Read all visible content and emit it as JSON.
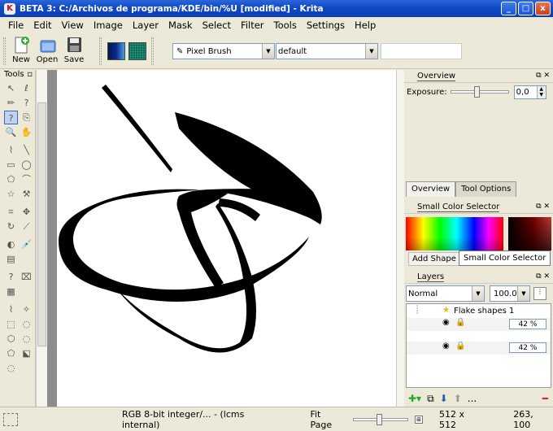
{
  "window": {
    "title": "BETA 3: C:/Archivos de programa/KDE/bin/%U [modified] - Krita",
    "min_label": "_",
    "max_label": "□",
    "close_label": "x"
  },
  "menu": [
    "File",
    "Edit",
    "View",
    "Image",
    "Layer",
    "Mask",
    "Select",
    "Filter",
    "Tools",
    "Settings",
    "Help"
  ],
  "toolbar": {
    "new_label": "New",
    "open_label": "Open",
    "save_label": "Save",
    "fg_color": "#0a2a8a",
    "bg_color": "#0b6b5a",
    "brush": "Pixel Brush",
    "preset": "default"
  },
  "toolbox": {
    "title": "Tools"
  },
  "overview": {
    "title": "Overview",
    "exposure_label": "Exposure:",
    "exposure_value": "0,0"
  },
  "tabs": [
    "Overview",
    "Tool Options"
  ],
  "color_selector": {
    "title": "Small Color Selector",
    "add_shape": "Add Shape",
    "tooltip": "Small Color Selector"
  },
  "layers": {
    "title": "Layers",
    "mode": "Normal",
    "opacity": "100.00",
    "items": [
      {
        "name": "Flake shapes 1",
        "opacity": "42 %"
      },
      {
        "name": "",
        "opacity": "42 %"
      }
    ],
    "more": "..."
  },
  "status": {
    "colorspace": "RGB 8-bit integer/... - (lcms internal)",
    "zoom_label": "Fit Page",
    "size": "512 x 512",
    "coords": "263, 100"
  }
}
